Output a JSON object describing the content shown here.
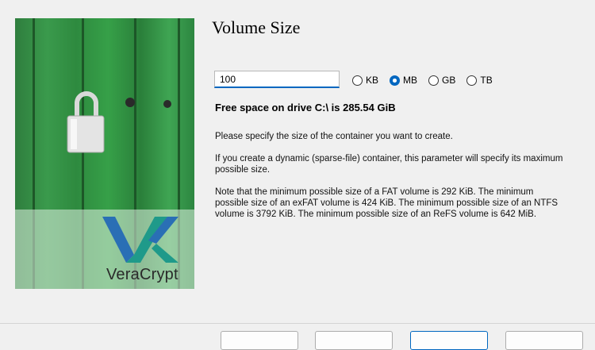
{
  "wizard": {
    "title": "Volume Size",
    "brand": "VeraCrypt"
  },
  "size": {
    "value": "100"
  },
  "units": [
    {
      "label": "KB",
      "selected": false
    },
    {
      "label": "MB",
      "selected": true
    },
    {
      "label": "GB",
      "selected": false
    },
    {
      "label": "TB",
      "selected": false
    }
  ],
  "free_space_text": "Free space on drive C:\\ is 285.54 GiB",
  "paragraphs": [
    "Please specify the size of the container you want to create.",
    "If you create a dynamic (sparse-file) container, this parameter will specify its maximum possible size.",
    "Note that the minimum possible size of a FAT volume is 292 KiB. The minimum possible size of an exFAT volume is 424 KiB. The minimum possible size of an NTFS volume is 3792 KiB. The minimum possible size of an ReFS volume is 642 MiB."
  ],
  "colors": {
    "accent": "#0067c0",
    "image_green": "#2e8a3f"
  }
}
